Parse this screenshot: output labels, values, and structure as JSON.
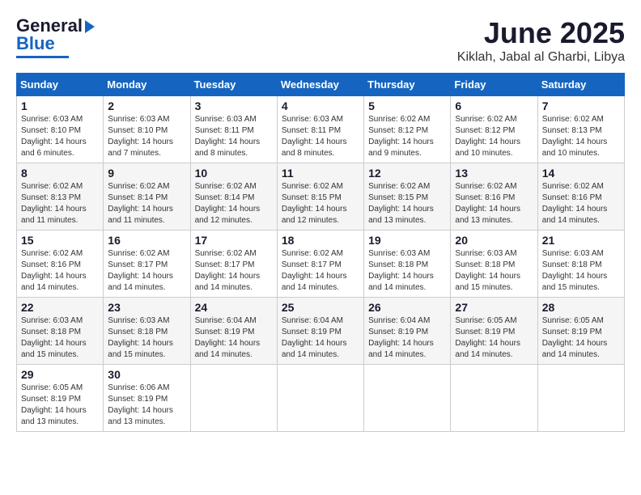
{
  "logo": {
    "line1": "General",
    "line2": "Blue",
    "subtitle": ""
  },
  "title": "June 2025",
  "subtitle": "Kiklah, Jabal al Gharbi, Libya",
  "headers": [
    "Sunday",
    "Monday",
    "Tuesday",
    "Wednesday",
    "Thursday",
    "Friday",
    "Saturday"
  ],
  "weeks": [
    [
      {
        "day": "1",
        "info": "Sunrise: 6:03 AM\nSunset: 8:10 PM\nDaylight: 14 hours\nand 6 minutes."
      },
      {
        "day": "2",
        "info": "Sunrise: 6:03 AM\nSunset: 8:10 PM\nDaylight: 14 hours\nand 7 minutes."
      },
      {
        "day": "3",
        "info": "Sunrise: 6:03 AM\nSunset: 8:11 PM\nDaylight: 14 hours\nand 8 minutes."
      },
      {
        "day": "4",
        "info": "Sunrise: 6:03 AM\nSunset: 8:11 PM\nDaylight: 14 hours\nand 8 minutes."
      },
      {
        "day": "5",
        "info": "Sunrise: 6:02 AM\nSunset: 8:12 PM\nDaylight: 14 hours\nand 9 minutes."
      },
      {
        "day": "6",
        "info": "Sunrise: 6:02 AM\nSunset: 8:12 PM\nDaylight: 14 hours\nand 10 minutes."
      },
      {
        "day": "7",
        "info": "Sunrise: 6:02 AM\nSunset: 8:13 PM\nDaylight: 14 hours\nand 10 minutes."
      }
    ],
    [
      {
        "day": "8",
        "info": "Sunrise: 6:02 AM\nSunset: 8:13 PM\nDaylight: 14 hours\nand 11 minutes."
      },
      {
        "day": "9",
        "info": "Sunrise: 6:02 AM\nSunset: 8:14 PM\nDaylight: 14 hours\nand 11 minutes."
      },
      {
        "day": "10",
        "info": "Sunrise: 6:02 AM\nSunset: 8:14 PM\nDaylight: 14 hours\nand 12 minutes."
      },
      {
        "day": "11",
        "info": "Sunrise: 6:02 AM\nSunset: 8:15 PM\nDaylight: 14 hours\nand 12 minutes."
      },
      {
        "day": "12",
        "info": "Sunrise: 6:02 AM\nSunset: 8:15 PM\nDaylight: 14 hours\nand 13 minutes."
      },
      {
        "day": "13",
        "info": "Sunrise: 6:02 AM\nSunset: 8:16 PM\nDaylight: 14 hours\nand 13 minutes."
      },
      {
        "day": "14",
        "info": "Sunrise: 6:02 AM\nSunset: 8:16 PM\nDaylight: 14 hours\nand 14 minutes."
      }
    ],
    [
      {
        "day": "15",
        "info": "Sunrise: 6:02 AM\nSunset: 8:16 PM\nDaylight: 14 hours\nand 14 minutes."
      },
      {
        "day": "16",
        "info": "Sunrise: 6:02 AM\nSunset: 8:17 PM\nDaylight: 14 hours\nand 14 minutes."
      },
      {
        "day": "17",
        "info": "Sunrise: 6:02 AM\nSunset: 8:17 PM\nDaylight: 14 hours\nand 14 minutes."
      },
      {
        "day": "18",
        "info": "Sunrise: 6:02 AM\nSunset: 8:17 PM\nDaylight: 14 hours\nand 14 minutes."
      },
      {
        "day": "19",
        "info": "Sunrise: 6:03 AM\nSunset: 8:18 PM\nDaylight: 14 hours\nand 14 minutes."
      },
      {
        "day": "20",
        "info": "Sunrise: 6:03 AM\nSunset: 8:18 PM\nDaylight: 14 hours\nand 15 minutes."
      },
      {
        "day": "21",
        "info": "Sunrise: 6:03 AM\nSunset: 8:18 PM\nDaylight: 14 hours\nand 15 minutes."
      }
    ],
    [
      {
        "day": "22",
        "info": "Sunrise: 6:03 AM\nSunset: 8:18 PM\nDaylight: 14 hours\nand 15 minutes."
      },
      {
        "day": "23",
        "info": "Sunrise: 6:03 AM\nSunset: 8:18 PM\nDaylight: 14 hours\nand 15 minutes."
      },
      {
        "day": "24",
        "info": "Sunrise: 6:04 AM\nSunset: 8:19 PM\nDaylight: 14 hours\nand 14 minutes."
      },
      {
        "day": "25",
        "info": "Sunrise: 6:04 AM\nSunset: 8:19 PM\nDaylight: 14 hours\nand 14 minutes."
      },
      {
        "day": "26",
        "info": "Sunrise: 6:04 AM\nSunset: 8:19 PM\nDaylight: 14 hours\nand 14 minutes."
      },
      {
        "day": "27",
        "info": "Sunrise: 6:05 AM\nSunset: 8:19 PM\nDaylight: 14 hours\nand 14 minutes."
      },
      {
        "day": "28",
        "info": "Sunrise: 6:05 AM\nSunset: 8:19 PM\nDaylight: 14 hours\nand 14 minutes."
      }
    ],
    [
      {
        "day": "29",
        "info": "Sunrise: 6:05 AM\nSunset: 8:19 PM\nDaylight: 14 hours\nand 13 minutes."
      },
      {
        "day": "30",
        "info": "Sunrise: 6:06 AM\nSunset: 8:19 PM\nDaylight: 14 hours\nand 13 minutes."
      },
      {
        "day": "",
        "info": ""
      },
      {
        "day": "",
        "info": ""
      },
      {
        "day": "",
        "info": ""
      },
      {
        "day": "",
        "info": ""
      },
      {
        "day": "",
        "info": ""
      }
    ]
  ]
}
